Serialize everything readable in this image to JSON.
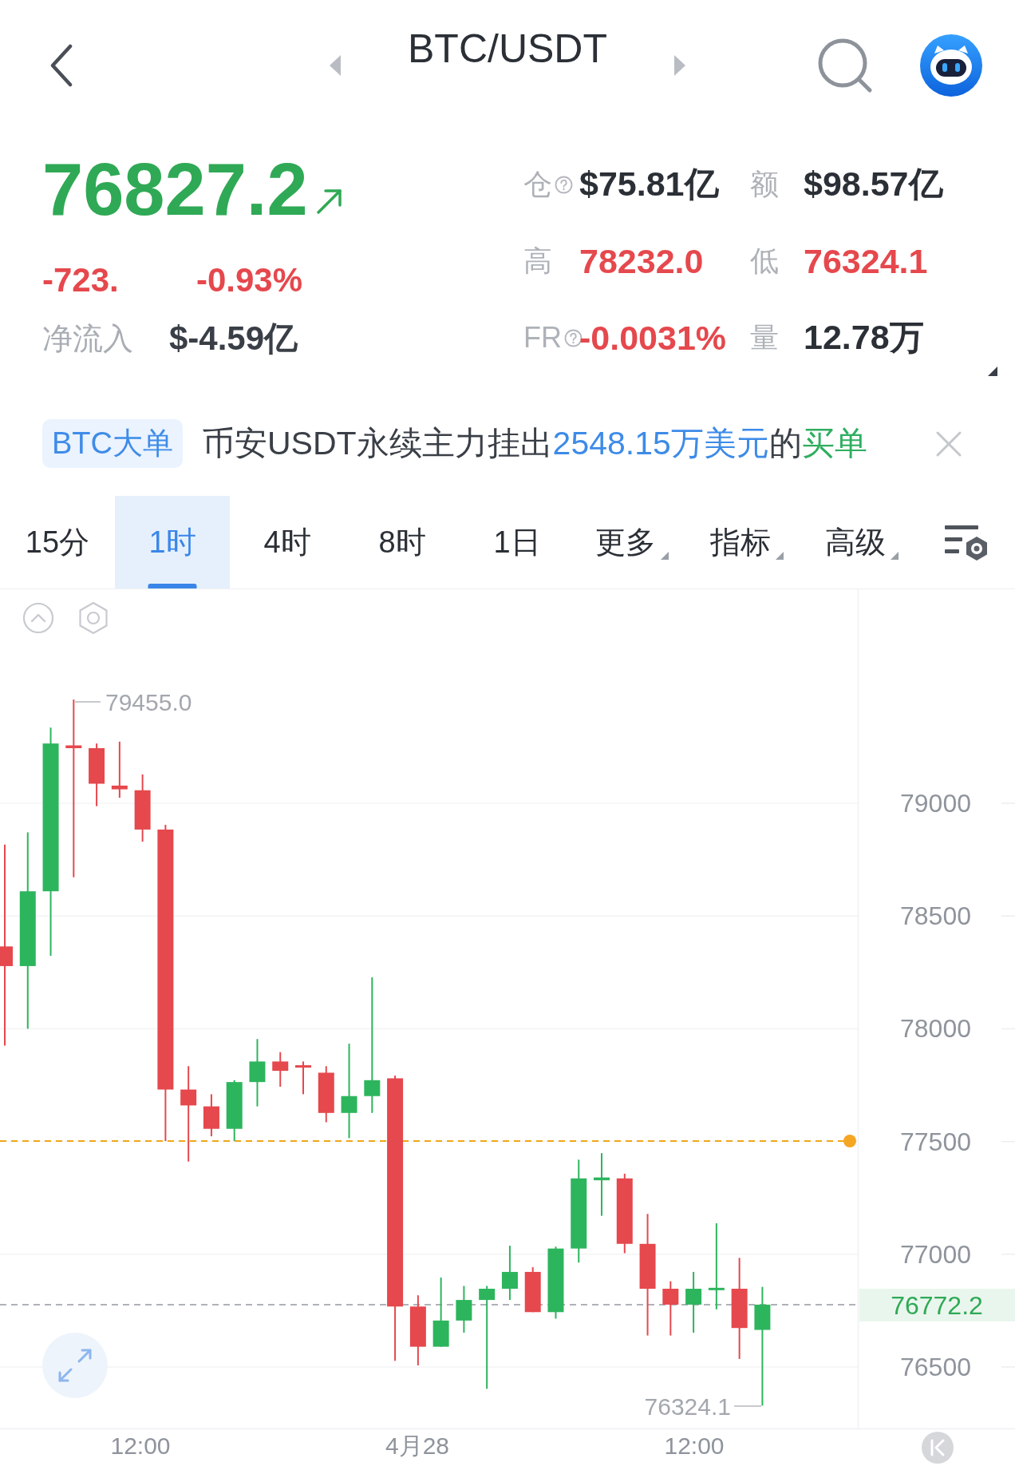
{
  "header": {
    "title": "BTC/USDT"
  },
  "ticker": {
    "price": "76827.2",
    "change": "-723.",
    "change_percent": "-0.93%",
    "net_inflow": {
      "label": "净流入",
      "value": "$-4.59亿"
    }
  },
  "stats": [
    {
      "label": "仓",
      "info_icon": true,
      "value": "$75.81亿",
      "color": "#2b2f36"
    },
    {
      "label": "额",
      "info_icon": false,
      "value": "$98.57亿",
      "color": "#2b2f36"
    },
    {
      "label": "高",
      "info_icon": false,
      "value": "78232.0",
      "color": "#e5484d"
    },
    {
      "label": "低",
      "info_icon": false,
      "value": "76324.1",
      "color": "#e5484d"
    },
    {
      "label": "FR",
      "info_icon": true,
      "value": "-0.0031%",
      "color": "#e5484d"
    },
    {
      "label": "量",
      "info_icon": false,
      "value": "12.78万",
      "color": "#2b2f36"
    }
  ],
  "alert": {
    "tag": "BTC大单",
    "message": [
      {
        "kind": "text",
        "text": "币安USDT永续主力挂出"
      },
      {
        "kind": "amount",
        "text": "2548.15万美元"
      },
      {
        "kind": "text",
        "text": "的"
      },
      {
        "kind": "side",
        "text": "买单"
      }
    ]
  },
  "tabs": [
    {
      "label": "15分",
      "kind": "period",
      "selected": false
    },
    {
      "label": "1时",
      "kind": "period",
      "selected": true
    },
    {
      "label": "4时",
      "kind": "period",
      "selected": false
    },
    {
      "label": "8时",
      "kind": "period",
      "selected": false
    },
    {
      "label": "1日",
      "kind": "period",
      "selected": false
    },
    {
      "label": "更多",
      "kind": "menu",
      "selected": false
    },
    {
      "label": "指标",
      "kind": "menu",
      "selected": false
    },
    {
      "label": "高级",
      "kind": "menu",
      "selected": false
    }
  ],
  "chart": {
    "high_label": "79455.0",
    "low_label": "76324.1",
    "current_price": "76772.2",
    "y_axis_labels": [
      "79000",
      "78500",
      "78000",
      "77500",
      "77000",
      "76500"
    ],
    "x_axis_labels": [
      "12:00",
      "4月28",
      "12:00"
    ]
  }
}
